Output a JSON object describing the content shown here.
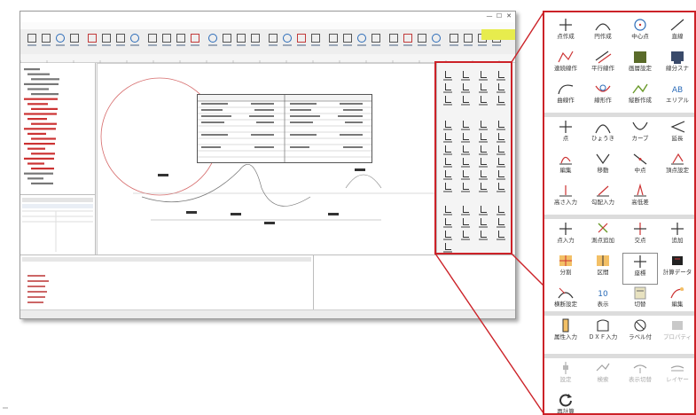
{
  "window": {
    "title": "",
    "controls": [
      "—",
      "☐",
      "✕"
    ]
  },
  "palette": {
    "sections": [
      {
        "tools": [
          {
            "label": "点作成",
            "icon": "plus-icon"
          },
          {
            "label": "円作成",
            "icon": "arc-icon"
          },
          {
            "label": "中心点",
            "icon": "circle-icon"
          },
          {
            "label": "直線",
            "icon": "line-icon"
          },
          {
            "label": "連続線作",
            "icon": "polyline-icon"
          },
          {
            "label": "平行線作",
            "icon": "parallel-icon"
          },
          {
            "label": "画層設定",
            "icon": "layer-icon"
          },
          {
            "label": "線分スナ",
            "icon": "snap-icon"
          },
          {
            "label": "曲線作",
            "icon": "curve-icon"
          },
          {
            "label": "線形作",
            "icon": "alignment-icon"
          },
          {
            "label": "縦断作成",
            "icon": "profile-icon"
          },
          {
            "label": "エリアル",
            "icon": "area-icon"
          }
        ]
      },
      {
        "tools": [
          {
            "label": "点",
            "icon": "plus-icon"
          },
          {
            "label": "ひょうき",
            "icon": "arch-icon"
          },
          {
            "label": "カーブ",
            "icon": "vcurve-icon"
          },
          {
            "label": "延長",
            "icon": "extend-icon"
          },
          {
            "label": "編集",
            "icon": "edit-icon"
          },
          {
            "label": "移動",
            "icon": "move-icon"
          },
          {
            "label": "中点",
            "icon": "midpoint-icon"
          },
          {
            "label": "頂点設定",
            "icon": "vertex-icon"
          },
          {
            "label": "高さ入力",
            "icon": "height-icon"
          },
          {
            "label": "勾配入力",
            "icon": "slope-icon"
          },
          {
            "label": "高低差",
            "icon": "diff-icon"
          }
        ]
      },
      {
        "tools": [
          {
            "label": "点入力",
            "icon": "plus-icon"
          },
          {
            "label": "測点追加",
            "icon": "station-icon"
          },
          {
            "label": "交点",
            "icon": "cross-icon"
          },
          {
            "label": "追加",
            "icon": "add-icon"
          },
          {
            "label": "分割",
            "icon": "split-icon"
          },
          {
            "label": "区間",
            "icon": "section-icon"
          },
          {
            "label": "座標",
            "icon": "coord-icon",
            "selected": true
          },
          {
            "label": "計算データ",
            "icon": "calc-icon"
          },
          {
            "label": "横断設定",
            "icon": "cross-section-icon"
          },
          {
            "label": "表示",
            "icon": "display-icon"
          },
          {
            "label": "切替",
            "icon": "switch-icon"
          },
          {
            "label": "編集",
            "icon": "edit2-icon"
          }
        ]
      },
      {
        "tools": [
          {
            "label": "属性入力",
            "icon": "attribute-icon"
          },
          {
            "label": "ＤＸＦ入力",
            "icon": "dxf-icon"
          },
          {
            "label": "ラベル付",
            "icon": "label-icon"
          },
          {
            "label": "プロパティ",
            "icon": "property-icon",
            "dim": true
          }
        ]
      },
      {
        "tools": [
          {
            "label": "設定",
            "icon": "setting-icon",
            "dim": true
          },
          {
            "label": "検索",
            "icon": "search-icon",
            "dim": true
          },
          {
            "label": "表示切替",
            "icon": "view-icon",
            "dim": true
          },
          {
            "label": "レイヤー",
            "icon": "layer2-icon",
            "dim": true
          },
          {
            "label": "再計算",
            "icon": "recalc-icon"
          }
        ]
      }
    ]
  },
  "colors": {
    "highlight": "#cc2228",
    "accent_toolbar": "#e7ec4d",
    "circle": "#d66b6b"
  }
}
